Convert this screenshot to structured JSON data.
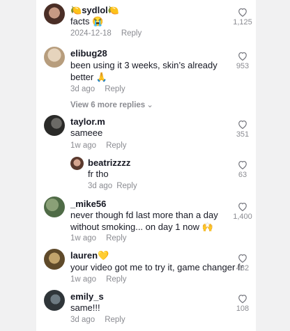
{
  "comments": [
    {
      "username": "sydlol",
      "emoji_before": "🍋",
      "emoji_after": "🍋",
      "text": "facts 😭",
      "date": "2024-12-18",
      "reply_label": "Reply",
      "likes": "1,125"
    },
    {
      "username": "elibug28",
      "text": "been using it 3 weeks, skin’s already better 🙏",
      "date": "3d ago",
      "reply_label": "Reply",
      "likes": "953"
    },
    {
      "username": "taylor.m",
      "text": "sameee",
      "date": "1w ago",
      "reply_label": "Reply",
      "likes": "351"
    },
    {
      "username": "_mike56",
      "text": "never though fd last more than a day without smoking... on day 1 now 🙌",
      "date": "1w ago",
      "reply_label": "Reply",
      "likes": "1,400"
    },
    {
      "username": "lauren",
      "emoji_after": "💛",
      "text": "your video got me to try it, game changer fr",
      "date": "1w ago",
      "reply_label": "Reply",
      "likes": "482"
    },
    {
      "username": "emily_s",
      "text": "same!!!",
      "date": "3d ago",
      "reply_label": "Reply",
      "likes": "108"
    }
  ],
  "view_more": "View 6 more replies",
  "reply": {
    "username": "beatrizzzz",
    "text": "fr tho",
    "date": "3d ago",
    "reply_label": "Reply",
    "likes": "63"
  },
  "colors": {
    "accent": "#161823",
    "muted": "#8a8b91",
    "background": "#ffffff"
  },
  "icons": {
    "like": "heart-outline-icon",
    "expand": "chevron-down-icon"
  }
}
